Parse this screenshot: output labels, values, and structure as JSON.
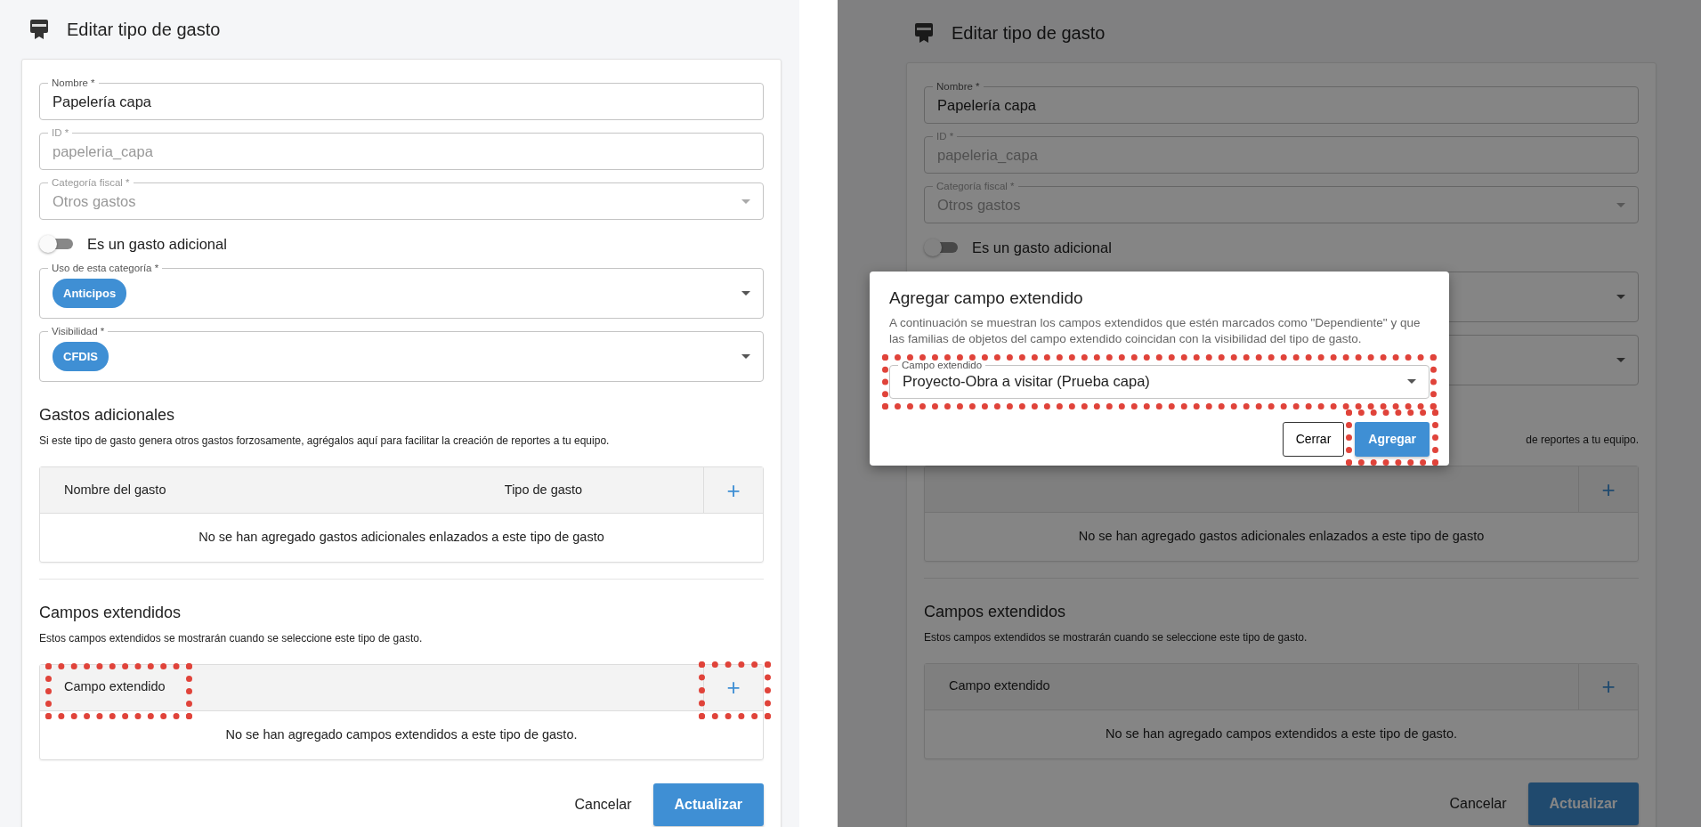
{
  "panels": [
    {
      "dimmed": false,
      "title": "Editar tipo de gasto",
      "fields": [
        {
          "kind": "text",
          "label": "Nombre *",
          "value": "Papelería capa",
          "disabled": false
        },
        {
          "kind": "text",
          "label": "ID *",
          "value": "papeleria_capa",
          "disabled": true
        },
        {
          "kind": "select",
          "label": "Categoría fiscal *",
          "value": "Otros gastos",
          "disabled": true
        },
        {
          "kind": "toggle",
          "label": "Es un gasto adicional",
          "on": false
        },
        {
          "kind": "chips",
          "label": "Uso de esta categoría *",
          "chips": [
            "Anticipos"
          ]
        },
        {
          "kind": "chips",
          "label": "Visibilidad *",
          "chips": [
            "CFDIS"
          ]
        }
      ],
      "sections": [
        {
          "title": "Gastos adicionales",
          "description": "Si este tipo de gasto genera otros gastos forzosamente, agrégalos aquí para facilitar la creación de reportes a tu equipo.",
          "columns": [
            {
              "label": "Nombre del gasto",
              "highlighted": false
            },
            {
              "label": "Tipo de gasto",
              "highlighted": false
            }
          ],
          "add_label": "+",
          "add_highlighted": false,
          "empty_text": "No se han agregado gastos adicionales enlazados a este tipo de gasto"
        },
        {
          "title": "Campos extendidos",
          "description": "Estos campos extendidos se mostrarán cuando se seleccione este tipo de gasto.",
          "columns": [
            {
              "label": "Campo extendido",
              "highlighted": true
            }
          ],
          "add_label": "+",
          "add_highlighted": true,
          "empty_text": "No se han agregado campos extendidos a este tipo de gasto."
        }
      ],
      "actions": {
        "cancel": "Cancelar",
        "submit": "Actualizar"
      }
    },
    {
      "dimmed": true,
      "title": "Editar tipo de gasto",
      "fields": [
        {
          "kind": "text",
          "label": "Nombre *",
          "value": "Papelería capa",
          "disabled": false
        },
        {
          "kind": "text",
          "label": "ID *",
          "value": "papeleria_capa",
          "disabled": true
        },
        {
          "kind": "select",
          "label": "Categoría fiscal *",
          "value": "Otros gastos",
          "disabled": true
        },
        {
          "kind": "toggle",
          "label": "Es un gasto adicional",
          "on": false
        },
        {
          "kind": "chips"
        },
        {
          "kind": "chips"
        }
      ],
      "sections": [
        {
          "description": "de reportes a tu equipo.",
          "add_label": "+",
          "add_highlighted": false,
          "empty_text": "No se han agregado gastos adicionales enlazados a este tipo de gasto"
        },
        {
          "title": "Campos extendidos",
          "description": "Estos campos extendidos se mostrarán cuando se seleccione este tipo de gasto.",
          "columns": [
            {
              "label": "Campo extendido",
              "highlighted": false
            }
          ],
          "add_label": "+",
          "add_highlighted": false,
          "empty_text": "No se han agregado campos extendidos a este tipo de gasto."
        }
      ],
      "actions": {
        "cancel": "Cancelar",
        "submit": "Actualizar"
      },
      "dialog": {
        "title": "Agregar campo extendido",
        "description": "A continuación se muestran los campos extendidos que estén marcados como \"Dependiente\" y que las familias de objetos del campo extendido coincidan con la visibilidad del tipo de gasto.",
        "field": {
          "label": "Campo extendido",
          "value": "Proyecto-Obra a visitar (Prueba capa)",
          "highlighted": true
        },
        "buttons": [
          {
            "kind": "outline",
            "label": "Cerrar",
            "highlighted": false
          },
          {
            "kind": "primary",
            "label": "Agregar",
            "highlighted": true
          }
        ]
      }
    }
  ]
}
